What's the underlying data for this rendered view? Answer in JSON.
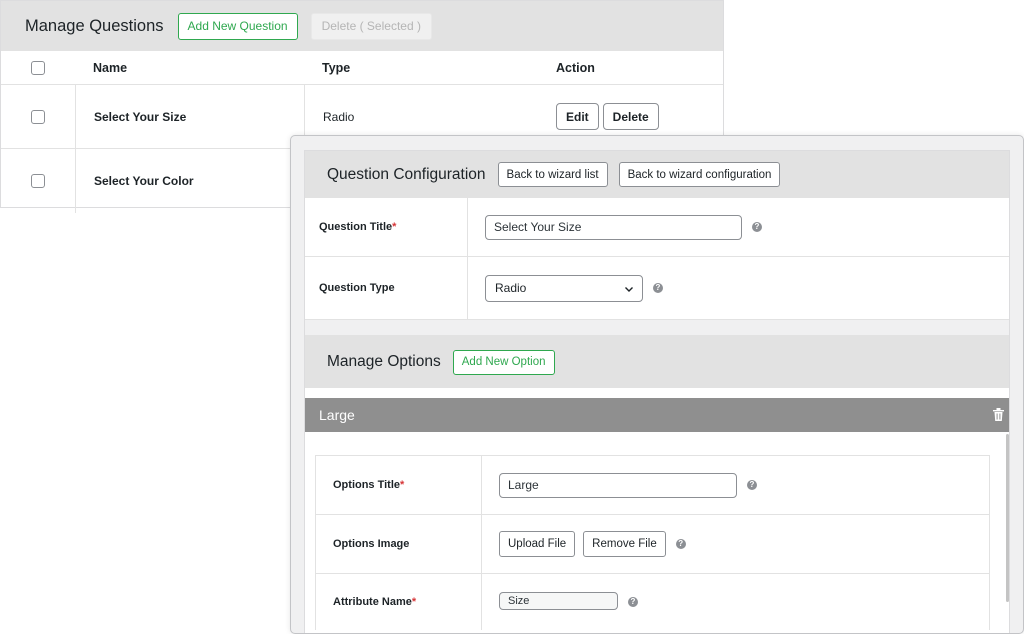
{
  "manage_questions": {
    "title": "Manage Questions",
    "add_button": "Add New Question",
    "delete_selected_button": "Delete ( Selected )",
    "columns": [
      "Name",
      "Type",
      "Action"
    ],
    "rows": [
      {
        "name": "Select Your Size",
        "type": "Radio",
        "edit": "Edit",
        "delete": "Delete"
      },
      {
        "name": "Select Your Color",
        "type": "",
        "edit": "",
        "delete": ""
      }
    ]
  },
  "question_config": {
    "title": "Question Configuration",
    "back_to_list": "Back to wizard list",
    "back_to_config": "Back to wizard configuration",
    "question_title_label": "Question Title",
    "question_title_value": "Select Your Size",
    "question_type_label": "Question Type",
    "question_type_value": "Radio",
    "required_mark": "*",
    "help_glyph": "?"
  },
  "manage_options": {
    "title": "Manage Options",
    "add_button": "Add New Option",
    "option": {
      "name": "Large",
      "title_label": "Options Title",
      "title_value": "Large",
      "image_label": "Options Image",
      "upload_button": "Upload File",
      "remove_button": "Remove File",
      "attribute_label": "Attribute Name",
      "attribute_value": "Size"
    }
  },
  "colors": {
    "accent_green": "#2fa84f",
    "header_gray": "#e2e2e2",
    "option_bar": "#8f8f8f",
    "required_red": "#d63638"
  }
}
